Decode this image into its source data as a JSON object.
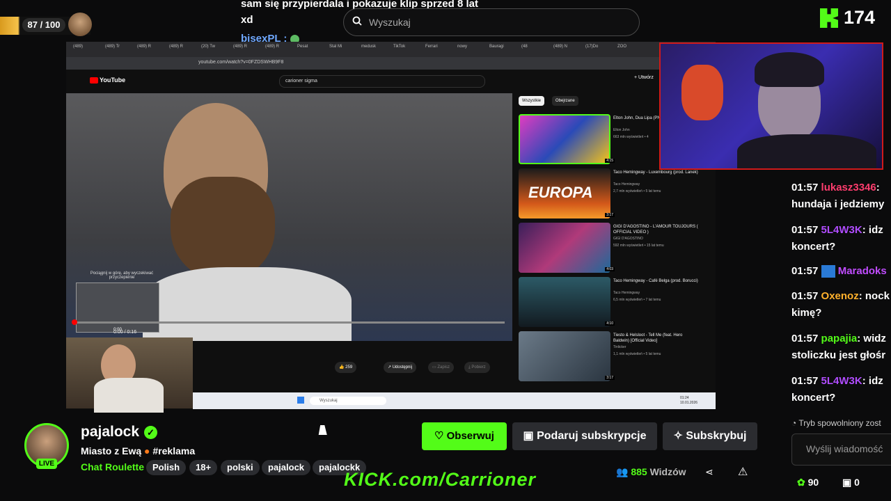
{
  "overlay": {
    "xp": "87 / 100",
    "chat_line1": "sam się przypierdala i pokazuje klip sprzed 8 lat",
    "chat_line2": "xd",
    "chat_line3": "bisexPL :",
    "search_placeholder": "Wyszukaj",
    "viewers_top": "174"
  },
  "browser": {
    "tabs": [
      "(489)",
      "(489) Tr",
      "(489) R",
      "(489) R",
      "(20) Tw",
      "(489) R",
      "(489) R",
      "Pesat",
      "Stal Mi",
      "medusk",
      "TikTok",
      "Ferrari",
      "nowy",
      "Bauragi",
      "(48",
      "(489) N",
      "(17)Do",
      "ZOO"
    ],
    "url": "youtube.com/watch?v=0FZDSWHB9F8",
    "yt_logo": "YouTube",
    "yt_search": "carioner sigma",
    "create_label": "Utwórz",
    "mini_hint": "Pociągnij w górę, aby wyczekiwać przyczepienie",
    "mini_time": "0:00",
    "player_time": "0:00 / 0:16",
    "actions": {
      "likes": "259",
      "share": "Udostępnij",
      "save": "Zapisz",
      "download": "Pobierz"
    },
    "chips": [
      "Wszystkie",
      "Obejrzane"
    ],
    "recommendations": [
      {
        "title": "Elton John, Dua Lipa (PNAU Remix) (Official",
        "channel": "Elton John",
        "meta": "663 mln wyświetleń • 4",
        "duration": "4:15",
        "color": "#8a2f9e"
      },
      {
        "title": "Taco Hemingway - Luxembourg (prod. Lanek)",
        "channel": "Taco Hemingway",
        "meta": "2,7 mln wyświetleń • 5 lat temu",
        "duration": "3:17",
        "color": "#9e3a12"
      },
      {
        "title": "GIGI D'AGOSTINO - L'AMOUR TOUJOURS ( OFFICIAL VIDEO )",
        "channel": "GIGI D'AGOSTINO",
        "meta": "592 mln wyświetleń • 15 lat temu",
        "duration": "4:03",
        "color": "#3c2b55"
      },
      {
        "title": "Taco Hemingway - Café Belga (prod. Borucci)",
        "channel": "Taco Hemingway",
        "meta": "6,5 mln wyświetleń • 7 lat temu",
        "duration": "4:10",
        "color": "#1f3b44"
      },
      {
        "title": "Tiesto & Helsloot - Tell Me (feat. Hero Baldwin) [Official Video]",
        "channel": "Tinlicker",
        "meta": "1,1 mln wyświetleń • 5 lat temu",
        "duration": "3:17",
        "color": "#4a5664"
      }
    ],
    "europa_text": "EUROPA",
    "taskbar_search": "Wyszukaj",
    "clock": "01:24",
    "date": "10.01.2026"
  },
  "chat": {
    "messages": [
      {
        "time": "01:57",
        "user": "lukasz3346",
        "color": "#ff3d6e",
        "text": ":",
        "cont": "hundaja i jedziemy"
      },
      {
        "time": "01:57",
        "user": "5L4W3K",
        "color": "#b04cff",
        "text": ": idz",
        "cont": "koncert?"
      },
      {
        "time": "01:57",
        "user": "Maradoks",
        "color": "#c04cff",
        "text": "",
        "cont": ""
      },
      {
        "time": "01:57",
        "user": "Oxenoz",
        "color": "#ffb12c",
        "text": ": nock",
        "cont": "kimę?"
      },
      {
        "time": "01:57",
        "user": "papajia",
        "color": "#53fc18",
        "text": ": widz",
        "cont": "stoliczku jest głośr"
      },
      {
        "time": "01:57",
        "user": "5L4W3K",
        "color": "#b04cff",
        "text": ": idz",
        "cont": "koncert?"
      }
    ],
    "slow_mode": "Tryb spowolniony zost",
    "input_placeholder": "Wyślij wiadomość",
    "points": "90",
    "gifts": "0"
  },
  "channel": {
    "name": "pajalock",
    "live": "LIVE",
    "title": "Miasto z Ewą",
    "title_tag": "#reklama",
    "category": "Chat Roulette",
    "tags": [
      "Polish",
      "18+",
      "polski",
      "pajalock",
      "pajalockk"
    ],
    "follow": "Obserwuj",
    "gift_sub": "Podaruj subskrypcje",
    "subscribe": "Subskrybuj",
    "viewers_count": "885",
    "viewers_label": "Widzów",
    "kick_url": "KICK.com/Carrioner"
  },
  "colors": {
    "accent": "#53fc18",
    "facecam_border": "#d01a1a"
  }
}
